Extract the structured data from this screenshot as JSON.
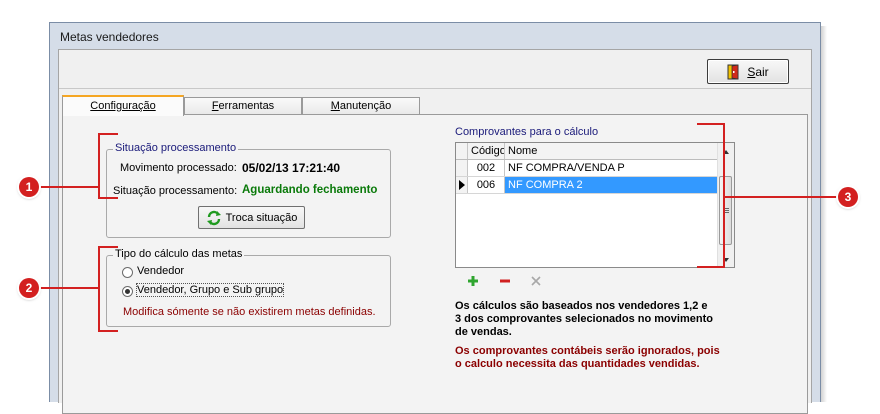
{
  "window": {
    "title": "Metas vendedores"
  },
  "toolbar": {
    "exit_label": "Sair",
    "exit_mnemonic": "S",
    "exit_rest": "air"
  },
  "tabs": [
    {
      "label": "Configuração"
    },
    {
      "label": "Ferramentas",
      "mnemonic": "F",
      "rest": "erramentas"
    },
    {
      "label": "Manutenção",
      "mnemonic": "M",
      "rest": "anutenção"
    }
  ],
  "situacao": {
    "group_label": "Situação processamento",
    "movimento_label": "Movimento processado:",
    "movimento_value": "05/02/13 17:21:40",
    "situacao_label": "Situação processamento:",
    "situacao_value": "Aguardando fechamento",
    "button_label": "Troca situação"
  },
  "tipo": {
    "group_label": "Tipo do cálculo das metas",
    "options": [
      {
        "label": "Vendedor",
        "selected": false
      },
      {
        "label": "Vendedor, Grupo e Sub grupo",
        "selected": true
      }
    ],
    "note": "Modifica sómente se não existirem metas definidas."
  },
  "comprovantes": {
    "label": "Comprovantes para o cálculo",
    "columns": [
      "Código",
      "Nome"
    ],
    "rows": [
      {
        "codigo": "002",
        "nome": "NF COMPRA/VENDA P",
        "selected": false
      },
      {
        "codigo": "006",
        "nome": "NF COMPRA 2",
        "selected": true
      }
    ],
    "actions": [
      "add-icon",
      "remove-icon",
      "clear-icon"
    ]
  },
  "info": {
    "text1": "Os cálculos são baseados nos vendedores 1,2 e 3 dos comprovantes selecionados no movimento de vendas.",
    "line1a": "Os cálculos são baseados nos vendedores 1,2 e",
    "line1b": "3 dos comprovantes selecionados no movimento",
    "line1c": "de vendas.",
    "line2a": "Os comprovantes contábeis serão ignorados, pois",
    "line2b": "o calculo necessita das quantidades vendidas."
  },
  "callouts": [
    "1",
    "2",
    "3"
  ],
  "colors": {
    "callout": "#d32020",
    "green": "#0a7a0a",
    "darkred": "#8b0000",
    "selection": "#3399ff",
    "tab_accent": "#f5a623"
  }
}
